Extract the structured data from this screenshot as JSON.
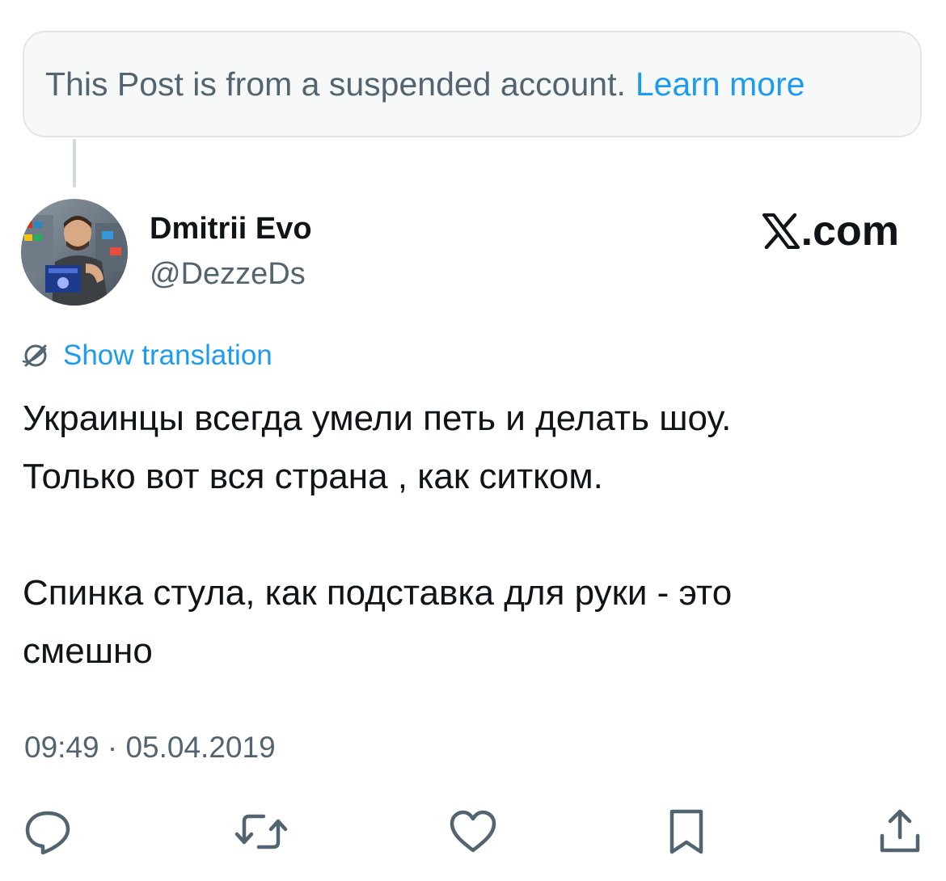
{
  "notice": {
    "text": "This Post is from a suspended account.",
    "link": "Learn more"
  },
  "author": {
    "display_name": "Dmitrii Evo",
    "handle": "@DezzeDs"
  },
  "brand": {
    "suffix": ".com",
    "icon": "x-logo-icon"
  },
  "translation": {
    "label": "Show translation",
    "icon": "globe-icon"
  },
  "post": {
    "paragraph_1": "Украинцы всегда умели петь и делать шоу.\nТолько вот вся страна , как ситком.",
    "paragraph_2": "Спинка стула, как подставка для руки - это\nсмешно"
  },
  "timestamp": "09:49 · 05.04.2019",
  "actions": [
    {
      "icon": "reply-icon"
    },
    {
      "icon": "repost-icon"
    },
    {
      "icon": "like-icon"
    },
    {
      "icon": "bookmark-icon"
    },
    {
      "icon": "share-icon"
    }
  ],
  "colors": {
    "accent": "#1d9bf0",
    "secondary_text": "#536471",
    "primary_text": "#0f1419",
    "notice_bg": "#f7f9f9"
  }
}
